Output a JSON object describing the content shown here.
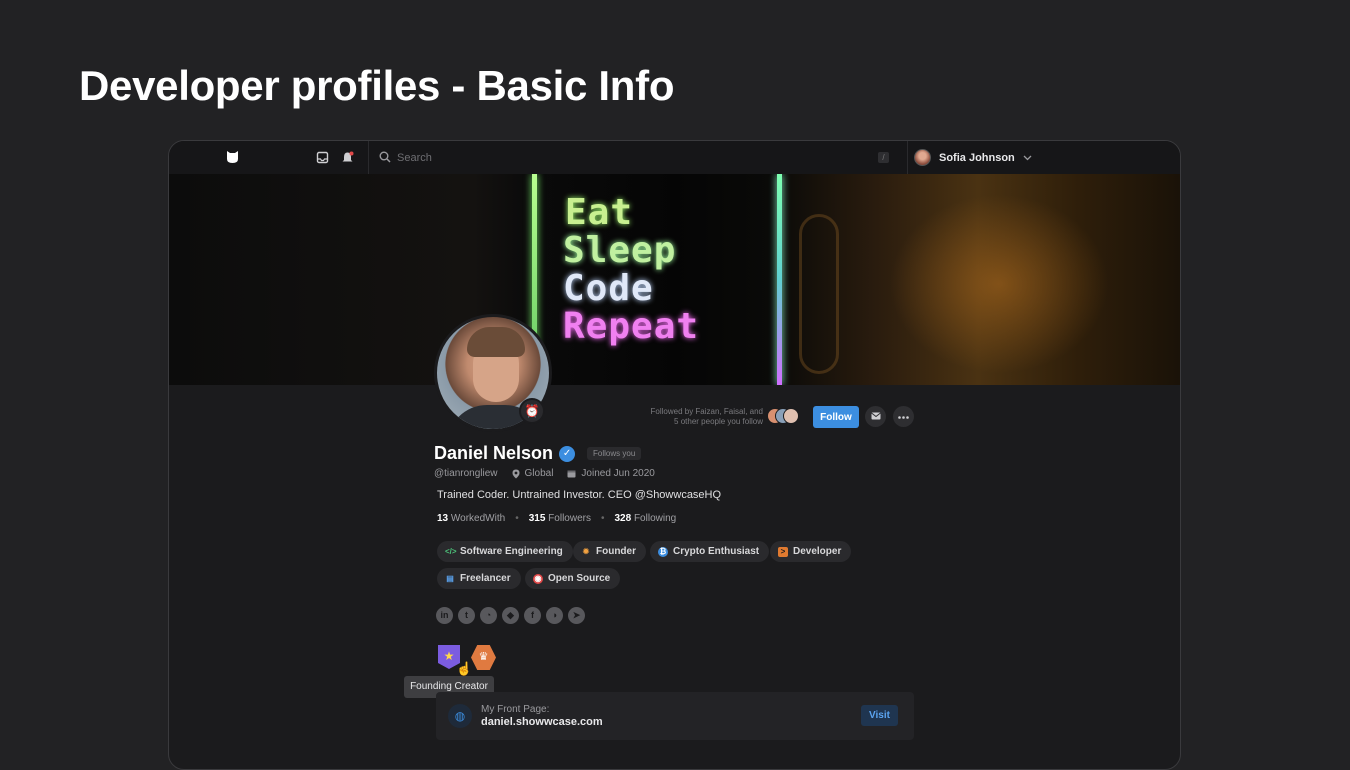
{
  "slide": {
    "title": "Developer profiles - Basic Info"
  },
  "topbar": {
    "search_placeholder": "Search",
    "shortcut_key": "/",
    "user_name": "Sofia Johnson"
  },
  "banner": {
    "lines": [
      "Eat",
      "Sleep",
      "Code",
      "Repeat"
    ]
  },
  "profile": {
    "name": "Daniel Nelson",
    "follows_you": "Follows you",
    "handle": "@tianrongliew",
    "location": "Global",
    "joined": "Joined Jun 2020",
    "bio": "Trained Coder. Untrained Investor. CEO @ShowwcaseHQ",
    "stats": {
      "worked_with_count": "13",
      "worked_with_label": "WorkedWith",
      "followers_count": "315",
      "followers_label": "Followers",
      "following_count": "328",
      "following_label": "Following"
    },
    "followed_by_line1": "Followed by Faizan, Faisal, and",
    "followed_by_line2": "5 other people  you follow",
    "follow_label": "Follow"
  },
  "tags": [
    {
      "label": "Software Engineering",
      "icon": "code-icon",
      "color": "#4cc37a"
    },
    {
      "label": "Founder",
      "icon": "lightbulb-icon",
      "color": "#f0a040"
    },
    {
      "label": "Crypto Enthusiast",
      "icon": "bitcoin-icon",
      "color": "#3c8ee0"
    },
    {
      "label": "Developer",
      "icon": "terminal-icon",
      "color": "#e07a30"
    },
    {
      "label": "Freelancer",
      "icon": "briefcase-icon",
      "color": "#5ba4f0"
    },
    {
      "label": "Open Source",
      "icon": "open-source-icon",
      "color": "#e04848"
    }
  ],
  "socials": [
    "linkedin-icon",
    "twitter-icon",
    "github-icon",
    "gitlab-icon",
    "facebook-icon",
    "discord-icon",
    "telegram-icon"
  ],
  "badges": {
    "tooltip": "Founding Creator"
  },
  "front_page": {
    "label": "My Front Page:",
    "url": "daniel.showwcase.com",
    "visit_label": "Visit"
  }
}
